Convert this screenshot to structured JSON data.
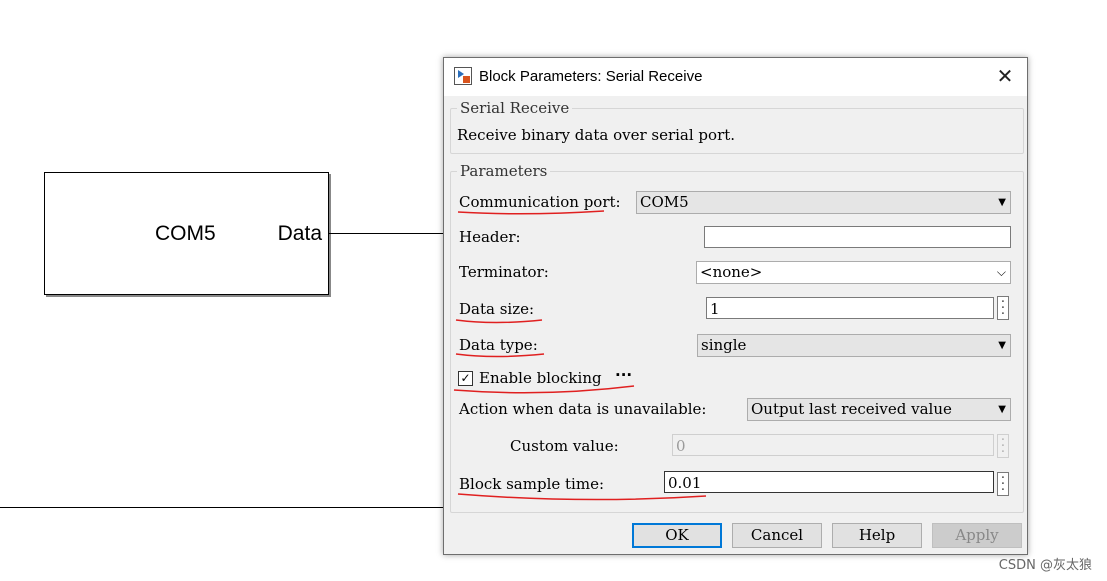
{
  "canvas": {
    "block": {
      "port_label": "COM5",
      "output_label": "Data"
    }
  },
  "dialog": {
    "title": "Block Parameters: Serial Receive",
    "close_icon": "close-icon",
    "description_group": {
      "title": "Serial Receive",
      "text": "Receive binary data over serial port."
    },
    "parameters_group": {
      "title": "Parameters",
      "communication_port": {
        "label": "Communication port:",
        "value": "COM5"
      },
      "header": {
        "label": "Header:",
        "value": ""
      },
      "terminator": {
        "label": "Terminator:",
        "value": "<none>"
      },
      "data_size": {
        "label": "Data size:",
        "value": "1"
      },
      "data_type": {
        "label": "Data type:",
        "value": "single"
      },
      "enable_blocking": {
        "label": "Enable blocking",
        "checked": true,
        "annotation": "···"
      },
      "action_unavailable": {
        "label": "Action when data is unavailable:",
        "value": "Output last received value"
      },
      "custom_value": {
        "label": "Custom value:",
        "value": "0"
      },
      "sample_time": {
        "label": "Block sample time:",
        "value": "0.01"
      }
    },
    "buttons": {
      "ok": "OK",
      "cancel": "Cancel",
      "help": "Help",
      "apply": "Apply"
    }
  },
  "watermark": "CSDN @灰太狼",
  "colors": {
    "annotation_red": "#e02020",
    "default_button_border": "#0078d7"
  }
}
